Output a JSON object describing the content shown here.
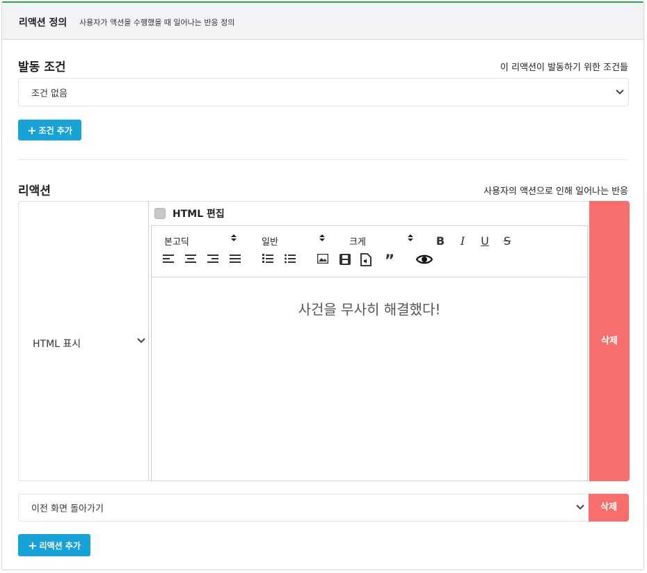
{
  "header": {
    "title": "리액션 정의",
    "subtitle": "사용자가 액션을 수행했을 때 일어나는 반응 정의"
  },
  "condition": {
    "title": "발동 조건",
    "help": "이 리액션이 발동하기 위한 조건들",
    "select_value": "조건 없음",
    "add_button": "조건 추가"
  },
  "reaction": {
    "title": "리액션",
    "help": "사용자의 액션으로 인해 일어나는 반응",
    "items": [
      {
        "type": "HTML 표시",
        "html_edit_label": "HTML 편집",
        "html_edit_checked": false,
        "toolbar": {
          "font": "본고딕",
          "style": "일반",
          "size": "크게"
        },
        "content": "사건을 무사히 해결했다!",
        "delete_label": "삭제"
      },
      {
        "type": "이전 화면 돌아가기",
        "delete_label": "삭제"
      }
    ],
    "add_button": "리액션 추가"
  },
  "colors": {
    "accent_info": "#17a2d8",
    "danger": "#f76e6c",
    "header_border_top": "#28a745"
  }
}
